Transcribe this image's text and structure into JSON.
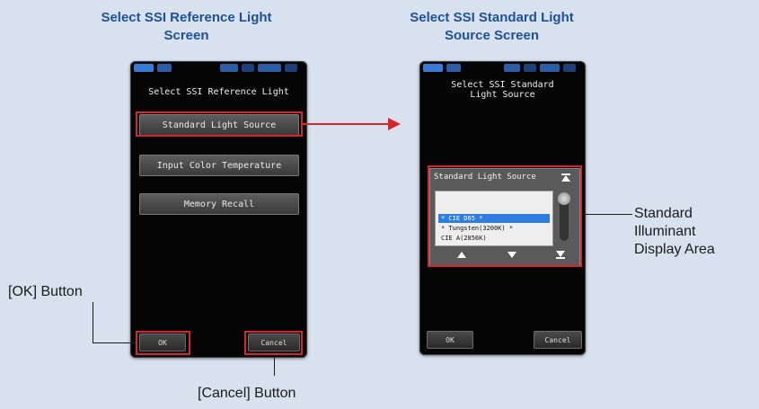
{
  "left_caption": {
    "line1": "Select SSI Reference Light",
    "line2": "Screen"
  },
  "right_caption": {
    "line1": "Select SSI Standard Light",
    "line2": "Source Screen"
  },
  "left_screen": {
    "title": "Select SSI Reference Light",
    "menu": [
      "Standard Light Source",
      "Input Color Temperature",
      "Memory Recall"
    ],
    "ok_label": "OK",
    "cancel_label": "Cancel"
  },
  "right_screen": {
    "title_line1": "Select SSI Standard",
    "title_line2": "Light Source",
    "panel_title": "Standard Light Source",
    "list_items": [
      "* CIE D65 *",
      "* Tungsten(3200K) *",
      "CIE A(2856K)"
    ],
    "ok_label": "OK",
    "cancel_label": "Cancel"
  },
  "callouts": {
    "ok_button": "[OK] Button",
    "cancel_button": "[Cancel] Button",
    "display_area_l1": "Standard",
    "display_area_l2": "Illuminant",
    "display_area_l3": "Display Area"
  },
  "colors": {
    "highlight": "#d6262b",
    "caption": "#1f4f96",
    "background": "#d7e2ee"
  }
}
